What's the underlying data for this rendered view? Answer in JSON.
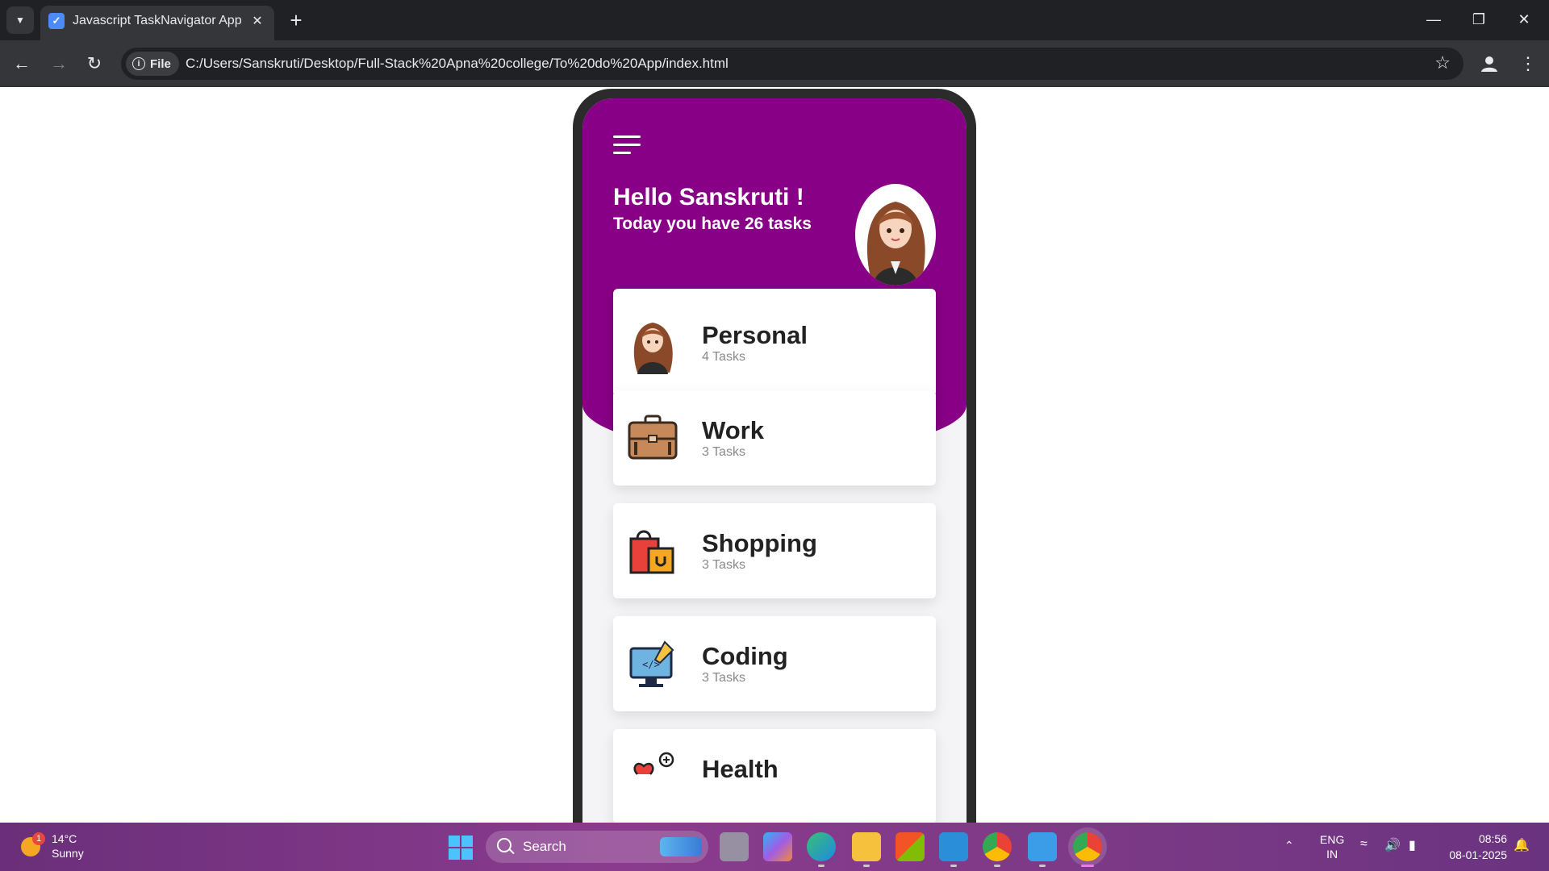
{
  "browser": {
    "tab_title": "Javascript TaskNavigator App",
    "site_chip_label": "File",
    "url": "C:/Users/Sanskruti/Desktop/Full-Stack%20Apna%20college/To%20do%20App/index.html",
    "accent_color": "#870085"
  },
  "app": {
    "greeting": "Hello Sanskruti !",
    "subtitle": "Today you have 26 tasks",
    "categories": [
      {
        "name": "Personal",
        "count": "4 Tasks",
        "icon": "girl-avatar-icon"
      },
      {
        "name": "Work",
        "count": "3 Tasks",
        "icon": "briefcase-icon"
      },
      {
        "name": "Shopping",
        "count": "3 Tasks",
        "icon": "shopping-bags-icon"
      },
      {
        "name": "Coding",
        "count": "3 Tasks",
        "icon": "monitor-code-icon"
      },
      {
        "name": "Health",
        "count": "",
        "icon": "health-icon"
      }
    ]
  },
  "taskbar": {
    "weather_badge": "1",
    "weather_temp": "14°C",
    "weather_condition": "Sunny",
    "search_label": "Search",
    "lang_line1": "ENG",
    "lang_line2": "IN",
    "time": "08:56",
    "date": "08-01-2025"
  }
}
